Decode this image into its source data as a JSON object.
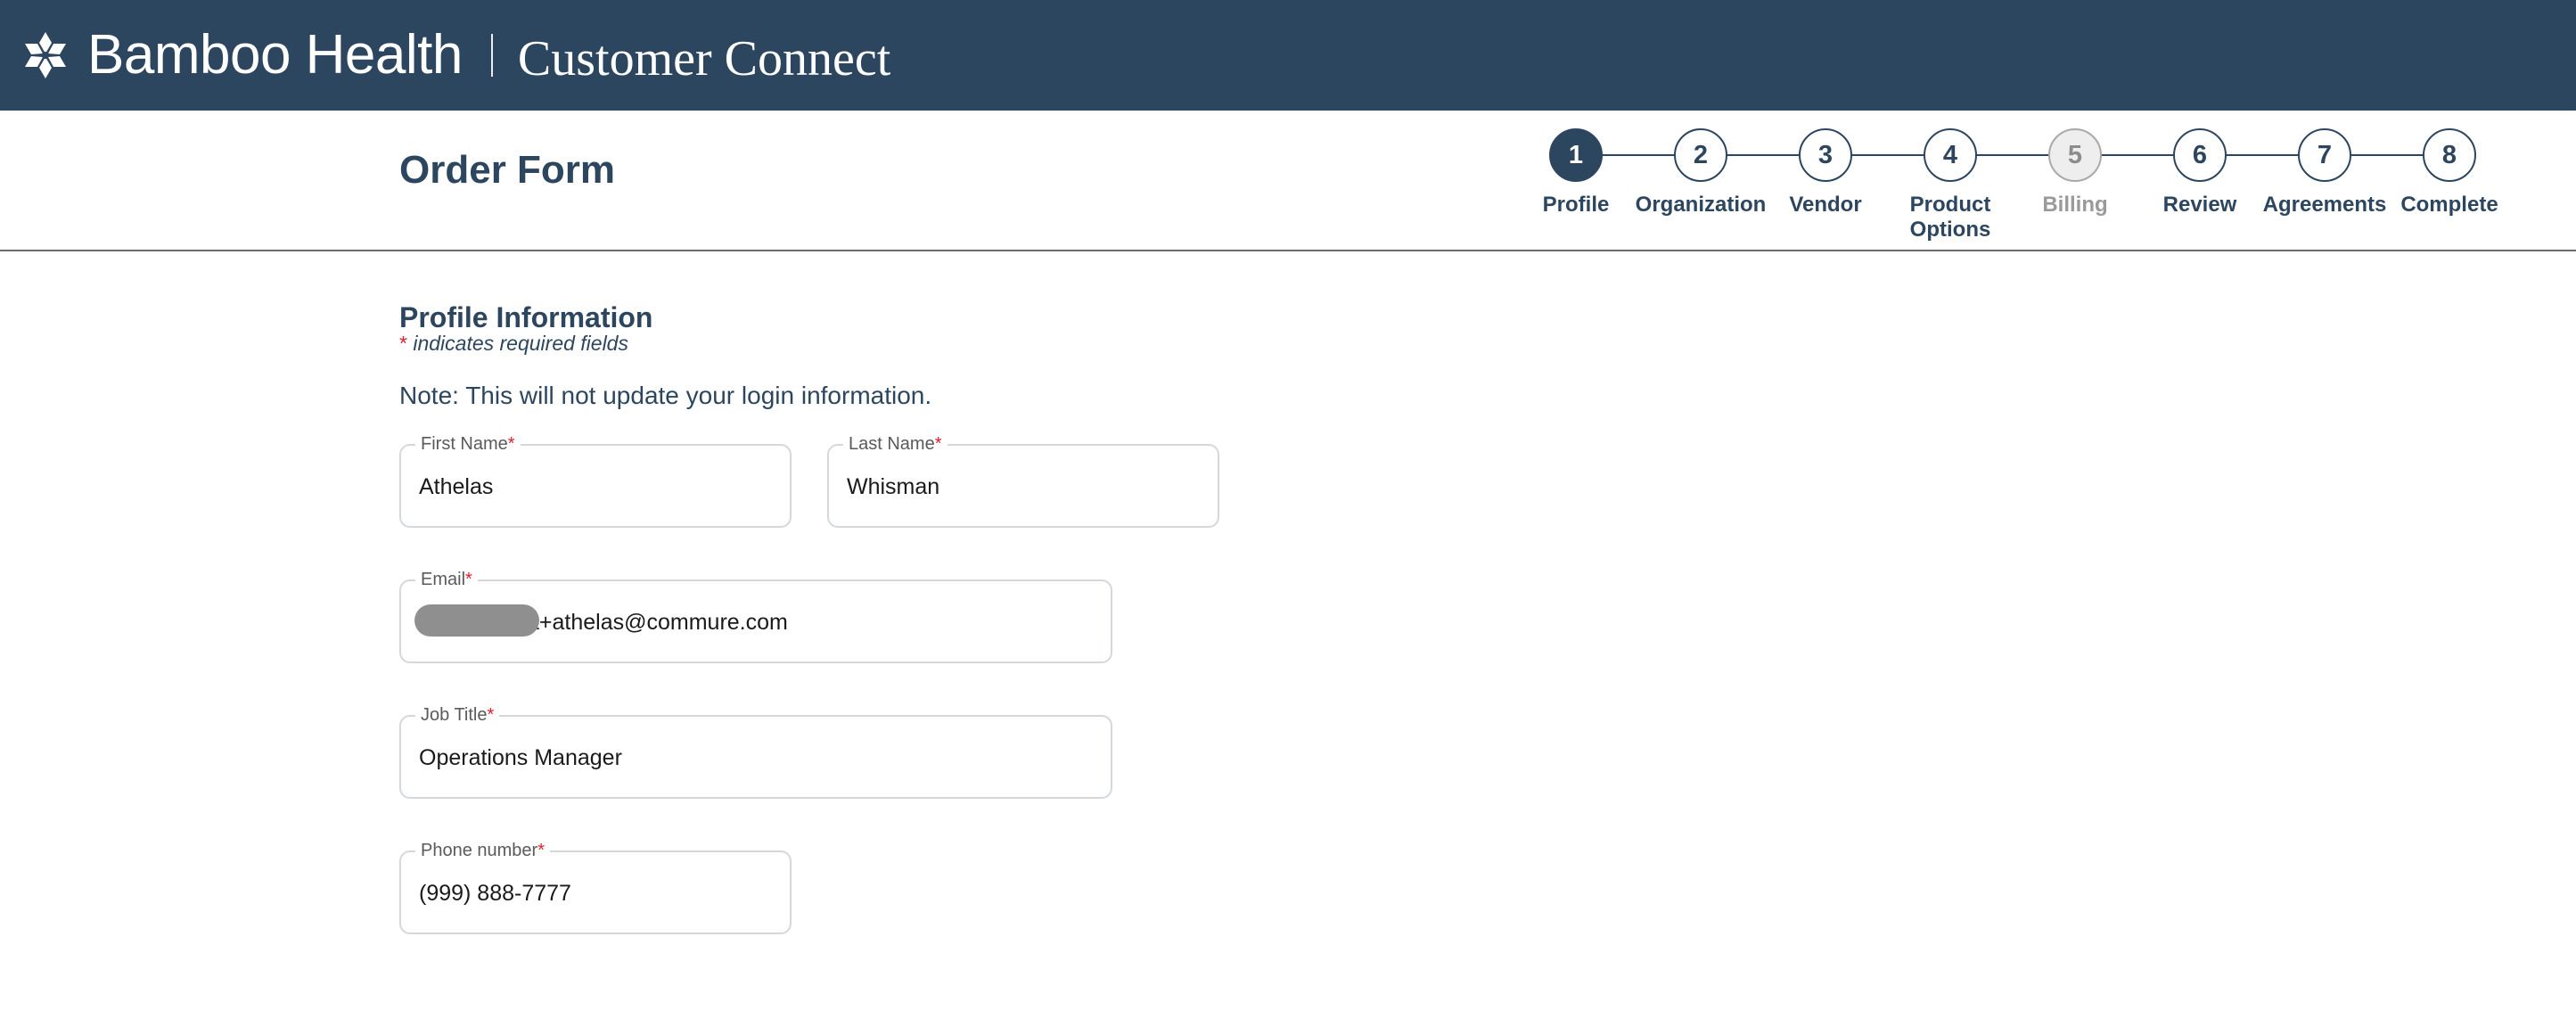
{
  "header": {
    "brand": "Bamboo Health",
    "product": "Customer Connect",
    "logo_icon": "bamboo-health-logo-icon",
    "background_color": "#2d4660"
  },
  "page": {
    "title": "Order Form"
  },
  "stepper": {
    "steps": [
      {
        "number": "1",
        "label": "Profile",
        "state": "active"
      },
      {
        "number": "2",
        "label": "Organization",
        "state": "default"
      },
      {
        "number": "3",
        "label": "Vendor",
        "state": "default"
      },
      {
        "number": "4",
        "label": "Product Options",
        "state": "default"
      },
      {
        "number": "5",
        "label": "Billing",
        "state": "disabled"
      },
      {
        "number": "6",
        "label": "Review",
        "state": "default"
      },
      {
        "number": "7",
        "label": "Agreements",
        "state": "default"
      },
      {
        "number": "8",
        "label": "Complete",
        "state": "default"
      }
    ]
  },
  "form": {
    "section_title": "Profile Information",
    "required_marker": "*",
    "required_note": "indicates required fields",
    "note": "Note: This will not update your login information.",
    "fields": {
      "first_name": {
        "label": "First Name",
        "value": "Athelas"
      },
      "last_name": {
        "label": "Last Name",
        "value": "Whisman"
      },
      "email": {
        "label": "Email",
        "value": "a+athelas@commure.com",
        "redacted": true
      },
      "job_title": {
        "label": "Job Title",
        "value": "Operations Manager"
      },
      "phone": {
        "label": "Phone number",
        "value": "(999) 888-7777"
      }
    }
  },
  "colors": {
    "primary": "#2d4660",
    "required": "#e0202a",
    "disabled": "#9a9a9a"
  }
}
